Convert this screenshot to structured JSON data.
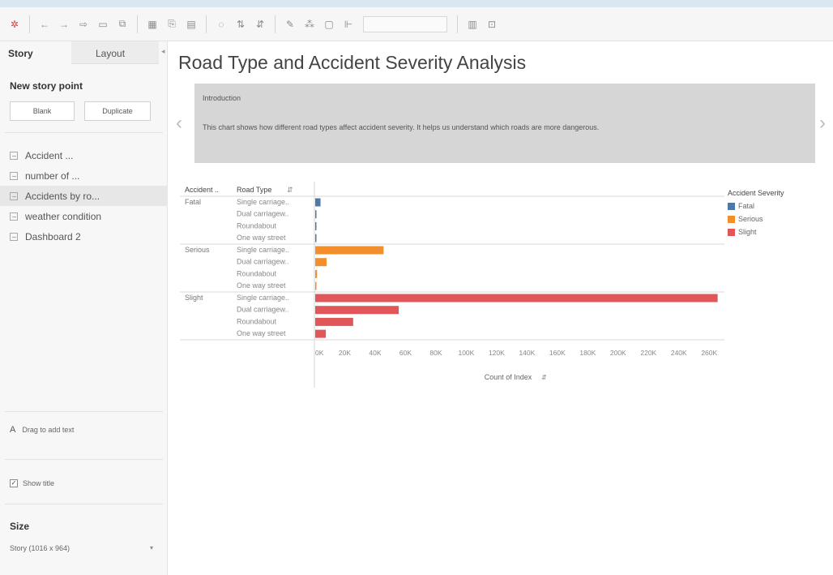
{
  "toolbar": {
    "icons": [
      "tableau-icon",
      "undo-icon",
      "redo-icon",
      "replay-icon",
      "save-icon",
      "new-datasource-icon",
      "new-worksheet-icon",
      "duplicate-icon",
      "clear-icon",
      "swap-icon",
      "sort-asc-icon",
      "sort-desc-icon",
      "highlight-icon",
      "group-icon",
      "labels-icon",
      "fix-axes-icon",
      "fit-dropdown",
      "show-cards-icon",
      "presentation-icon"
    ]
  },
  "sidebar": {
    "tabs": [
      {
        "label": "Story"
      },
      {
        "label": "Layout"
      }
    ],
    "new_story_point": "New story point",
    "blank_label": "Blank",
    "duplicate_label": "Duplicate",
    "sheets": [
      {
        "label": "Accident ..."
      },
      {
        "label": "number of ..."
      },
      {
        "label": "Accidents by ro..."
      },
      {
        "label": "weather condition"
      },
      {
        "label": "Dashboard 2"
      }
    ],
    "drag_text": "Drag to add text",
    "show_title": "Show title",
    "size_header": "Size",
    "size_value": "Story (1016 x 964)"
  },
  "story": {
    "title": "Road Type and Accident Severity Analysis",
    "caption_title": "Introduction",
    "caption_body": "This chart shows how different road types affect accident severity. It helps us understand which roads are more dangerous."
  },
  "chart_data": {
    "type": "bar",
    "orientation": "horizontal",
    "row_headers": [
      "Accident ..",
      "Road Type"
    ],
    "groups": [
      "Fatal",
      "Serious",
      "Slight"
    ],
    "categories": [
      "Single carriage..",
      "Dual carriagew..",
      "Roundabout",
      "One way street"
    ],
    "series": [
      {
        "name": "Fatal",
        "color": "#4e79a7",
        "values": [
          3500,
          600,
          100,
          50
        ]
      },
      {
        "name": "Serious",
        "color": "#f28e2b",
        "values": [
          45000,
          7500,
          1200,
          600
        ]
      },
      {
        "name": "Slight",
        "color": "#e15759",
        "values": [
          265000,
          55000,
          25000,
          7000
        ]
      }
    ],
    "xlabel": "Count of Index",
    "xticks": [
      "0K",
      "20K",
      "40K",
      "60K",
      "80K",
      "100K",
      "120K",
      "140K",
      "160K",
      "180K",
      "200K",
      "220K",
      "240K",
      "260K"
    ],
    "xlim": [
      0,
      270000
    ],
    "legend": {
      "title": "Accident Severity",
      "position": "right",
      "items": [
        "Fatal",
        "Serious",
        "Slight"
      ]
    }
  }
}
